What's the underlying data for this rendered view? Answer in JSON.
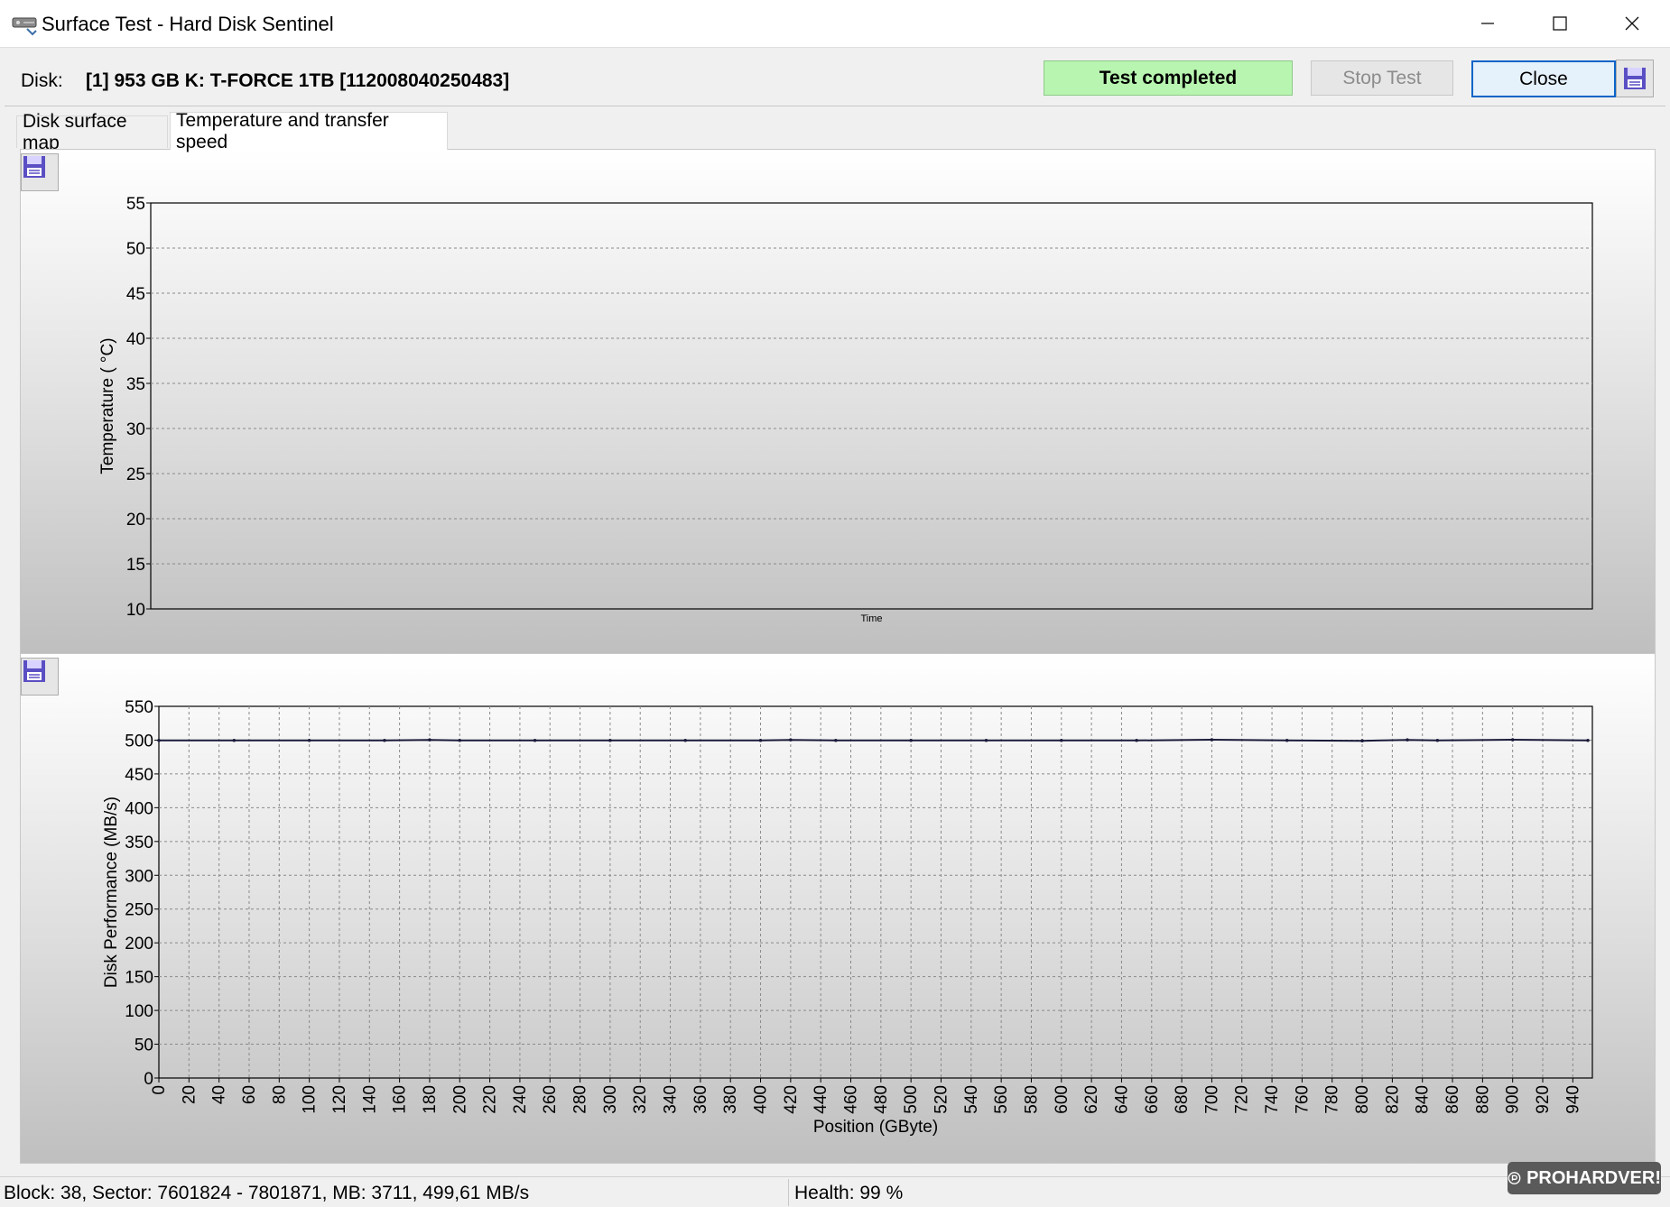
{
  "window": {
    "title": "Surface Test - Hard Disk Sentinel"
  },
  "header": {
    "disk_label": "Disk:",
    "disk_value": "[1] 953 GB K: T-FORCE 1TB [112008040250483]",
    "status": "Test completed",
    "stop_label": "Stop Test",
    "close_label": "Close"
  },
  "tabs": [
    {
      "label": "Disk surface map",
      "active": false
    },
    {
      "label": "Temperature and transfer speed",
      "active": true
    }
  ],
  "colors": {
    "status_bg": "#b8f5b0",
    "save_icon": "#5b4fc4",
    "series_line": "#1a1a3a"
  },
  "chart_data": [
    {
      "type": "line",
      "ylabel": "Temperature ( °C)",
      "xlabel": "Time",
      "ylim": [
        10,
        55
      ],
      "yticks": [
        10,
        15,
        20,
        25,
        30,
        35,
        40,
        45,
        50,
        55
      ],
      "grid": true,
      "series": []
    },
    {
      "type": "line",
      "ylabel": "Disk Performance (MB/s)",
      "xlabel": "Position (GByte)",
      "ylim": [
        0,
        550
      ],
      "xlim": [
        0,
        953
      ],
      "yticks": [
        0,
        50,
        100,
        150,
        200,
        250,
        300,
        350,
        400,
        450,
        500,
        550
      ],
      "xticks": [
        0,
        20,
        40,
        60,
        80,
        100,
        120,
        140,
        160,
        180,
        200,
        220,
        240,
        260,
        280,
        300,
        320,
        340,
        360,
        380,
        400,
        420,
        440,
        460,
        480,
        500,
        520,
        540,
        560,
        580,
        600,
        620,
        640,
        660,
        680,
        700,
        720,
        740,
        760,
        780,
        800,
        820,
        840,
        860,
        880,
        900,
        920,
        940
      ],
      "grid": true,
      "series": [
        {
          "x": [
            0,
            50,
            100,
            150,
            180,
            200,
            250,
            300,
            350,
            400,
            420,
            450,
            500,
            550,
            600,
            650,
            700,
            750,
            800,
            830,
            850,
            900,
            950
          ],
          "values": [
            499.6,
            499.6,
            499.6,
            499.6,
            500.4,
            499.6,
            499.6,
            499.6,
            499.6,
            499.6,
            500.4,
            499.6,
            499.6,
            499.6,
            499.6,
            499.6,
            500.6,
            499.6,
            499.0,
            500.4,
            499.6,
            500.6,
            499.6
          ]
        }
      ]
    }
  ],
  "status_bar": {
    "left": "Block: 38, Sector: 7601824 - 7801871, MB: 3711, 499,61 MB/s",
    "right": "Health: 99 %"
  },
  "watermark": {
    "text": "PROHARDVER!"
  }
}
